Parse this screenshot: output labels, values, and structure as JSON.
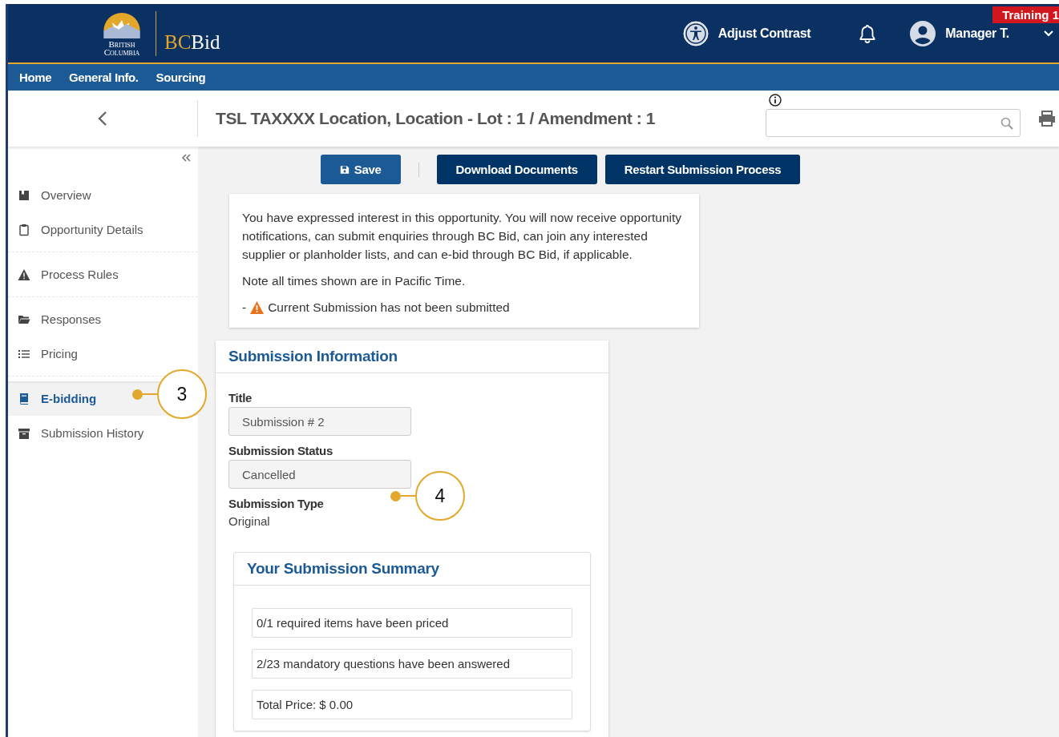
{
  "header": {
    "logo_text": "British Columbia",
    "brand": [
      "BC",
      "Bid"
    ],
    "contrast_label": "Adjust Contrast",
    "user": "Manager T.",
    "environment_badge": "Training 1"
  },
  "nav": {
    "items": [
      "Home",
      "General Info.",
      "Sourcing"
    ]
  },
  "title_bar": {
    "title": "TSL TAXXXX Location, Location - Lot : 1 / Amendment : 1"
  },
  "sidebar": {
    "groups": [
      {
        "items": [
          {
            "label": "Overview",
            "selected": false
          },
          {
            "label": "Opportunity Details",
            "selected": false
          }
        ]
      },
      {
        "items": [
          {
            "label": "Process Rules",
            "selected": false
          }
        ]
      },
      {
        "items": [
          {
            "label": "Responses",
            "selected": false
          },
          {
            "label": "Pricing",
            "selected": false
          }
        ]
      },
      {
        "items": [
          {
            "label": "E-bidding",
            "selected": true
          },
          {
            "label": "Submission History",
            "selected": false
          }
        ]
      }
    ]
  },
  "toolbar": {
    "buttons": [
      {
        "label": "Save",
        "kind": "primary"
      },
      {
        "kind": "separator"
      },
      {
        "label": "Download Documents",
        "kind": "dark"
      },
      {
        "label": "Restart Submission Process",
        "kind": "dark"
      }
    ]
  },
  "notice": {
    "paragraphs": [
      "You have expressed interest in this opportunity.  You will now receive opportunity notifications, can submit enquiries through BC Bid, can join any interested supplier or planholder lists, and can e-bid through BC Bid, if applicable.",
      "Note all times shown are in Pacific Time."
    ],
    "warning_prefix": "-",
    "warning": "Current Submission has not been submitted"
  },
  "submission_information": {
    "heading": "Submission Information",
    "fields": [
      {
        "label": "Title",
        "value": "Submission # 2",
        "kind": "input"
      },
      {
        "label": "Submission Status",
        "value": "Cancelled",
        "kind": "input"
      },
      {
        "label": "Submission Type",
        "value": "Original",
        "kind": "text"
      }
    ],
    "summary": {
      "heading": "Your Submission Summary",
      "items": [
        "0/1 required items have been priced",
        "2/23 mandatory questions have been answered",
        "Total Price: $ 0.00"
      ]
    }
  },
  "annotations": [
    {
      "label": "3"
    },
    {
      "label": "4"
    }
  ]
}
